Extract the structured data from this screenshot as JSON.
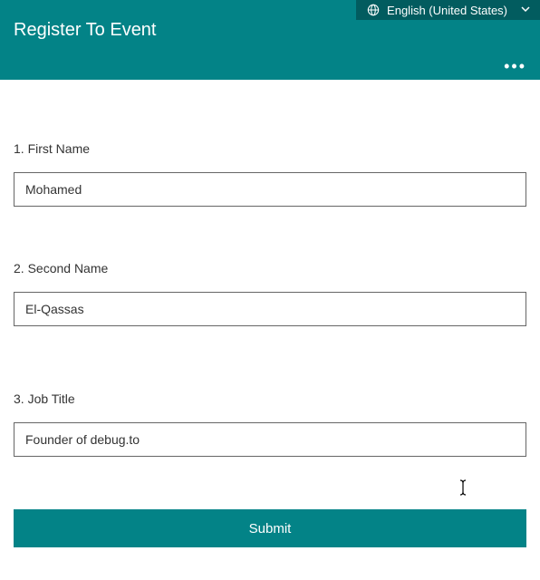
{
  "header": {
    "title": "Register To Event",
    "language_label": "English (United States)"
  },
  "fields": [
    {
      "label": "1. First Name",
      "value": "Mohamed"
    },
    {
      "label": "2. Second Name",
      "value": "El-Qassas"
    },
    {
      "label": "3. Job Title",
      "value": "Founder of debug.to"
    }
  ],
  "actions": {
    "submit_label": "Submit"
  }
}
